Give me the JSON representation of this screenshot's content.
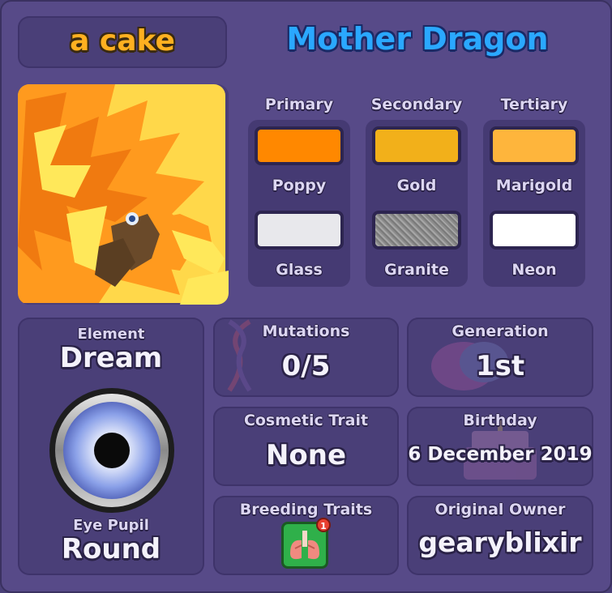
{
  "pet_name": "a cake",
  "species": "Mother Dragon",
  "colors": {
    "headers": [
      "Primary",
      "Secondary",
      "Tertiary"
    ],
    "swatches": [
      {
        "name": "Poppy",
        "hex": "#ff8800"
      },
      {
        "name": "Gold",
        "hex": "#f2b01a"
      },
      {
        "name": "Marigold",
        "hex": "#feb53c"
      }
    ],
    "materials": [
      {
        "name": "Glass",
        "hex": "#e8e8ec"
      },
      {
        "name": "Granite",
        "hex": "#8e8e8e"
      },
      {
        "name": "Neon",
        "hex": "#ffffff"
      }
    ]
  },
  "element": {
    "label": "Element",
    "value": "Dream"
  },
  "eye_pupil": {
    "label": "Eye Pupil",
    "value": "Round"
  },
  "mutations": {
    "label": "Mutations",
    "value": "0/5"
  },
  "generation": {
    "label": "Generation",
    "value": "1st"
  },
  "cosmetic_trait": {
    "label": "Cosmetic Trait",
    "value": "None"
  },
  "birthday": {
    "label": "Birthday",
    "value": "6 December 2019"
  },
  "breeding_traits": {
    "label": "Breeding Traits",
    "badge_count": "1",
    "icon": "lungs-icon"
  },
  "original_owner": {
    "label": "Original Owner",
    "value": "gearyblixir"
  },
  "accent_colors": {
    "name_tag": "#ffb020",
    "species": "#2aa8ff",
    "panel": "#4a3f78",
    "frame": "#574a88"
  }
}
